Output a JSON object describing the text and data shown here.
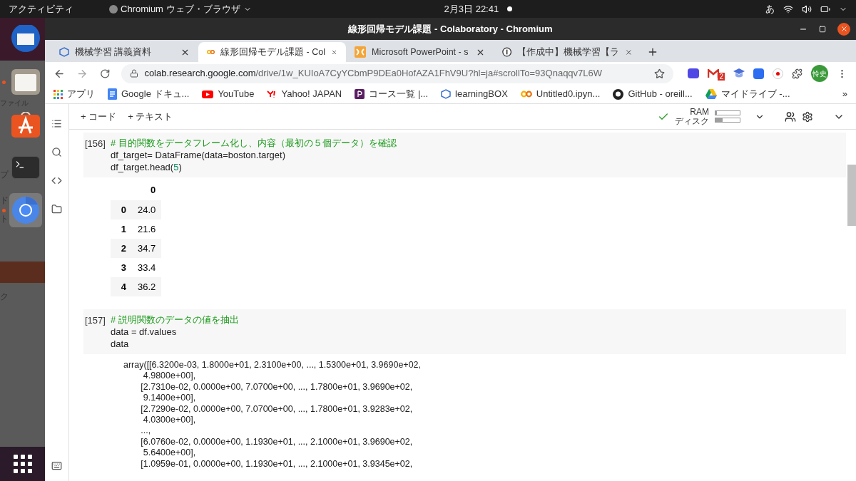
{
  "top_bar": {
    "activities": "アクティビティ",
    "app_menu": "Chromium ウェブ・ブラウザ",
    "clock": "2月3日  22:41",
    "input_method": "あ"
  },
  "dock": {
    "items": [
      {
        "kind": "mail",
        "running": false,
        "selected": false
      },
      {
        "kind": "files",
        "running": true,
        "selected": false
      },
      {
        "kind": "store",
        "running": false,
        "selected": false
      },
      {
        "kind": "terminal",
        "running": false,
        "selected": false
      },
      {
        "kind": "chromium",
        "running": true,
        "selected": true
      }
    ],
    "background_texts": [
      "ファイル",
      "プ",
      "ド",
      "ト",
      "ク"
    ]
  },
  "window": {
    "title": "線形回帰モデル課題 - Colaboratory - Chromium"
  },
  "tabs": [
    {
      "label": "機械学習 講義資料",
      "kind": "box",
      "selected": false
    },
    {
      "label": "線形回帰モデル課題 - Col",
      "kind": "colab",
      "selected": true
    },
    {
      "label": "Microsoft PowerPoint - s",
      "kind": "office",
      "selected": false
    },
    {
      "label": "【作成中】機械学習【ラ",
      "kind": "info",
      "selected": false
    }
  ],
  "address_bar": {
    "host": "colab.research.google.com",
    "path": "/drive/1w_KUIoA7CyYCbmP9DEa0HofAZA1FhV9U?hl=ja#scrollTo=93Qnaqqv7L6W"
  },
  "extensions": {
    "mail_badge": "2",
    "avatar": "怜史"
  },
  "bookmarks": [
    {
      "label": "アプリ",
      "kind": "apps"
    },
    {
      "label": "Google ドキュ...",
      "kind": "docs"
    },
    {
      "label": "YouTube",
      "kind": "youtube"
    },
    {
      "label": "Yahoo! JAPAN",
      "kind": "yahoo"
    },
    {
      "label": "コース一覧 |...",
      "kind": "course"
    },
    {
      "label": "learningBOX",
      "kind": "box"
    },
    {
      "label": "Untitled0.ipyn...",
      "kind": "colab"
    },
    {
      "label": "GitHub - oreill...",
      "kind": "github"
    },
    {
      "label": "マイドライブ -...",
      "kind": "drive"
    }
  ],
  "bookmarks_more": "»",
  "colab_toolbar": {
    "add_code": "+ コード",
    "add_text": "+ テキスト",
    "ram_label": "RAM",
    "disk_label": "ディスク",
    "ram": {
      "level": 0.05
    },
    "disk": {
      "level": 0.3
    }
  },
  "cells": [
    {
      "count": "[156]",
      "lines": [
        [
          {
            "kind": "comment",
            "text": "# 目的関数をデータフレーム化し、内容（最初の５個データ）を確認"
          }
        ],
        [
          {
            "kind": "plain",
            "text": "df_target= DataFrame(data=boston.target)"
          }
        ],
        [
          {
            "kind": "plain",
            "text": "df_target.head("
          },
          {
            "kind": "number",
            "text": "5"
          },
          {
            "kind": "plain",
            "text": ")"
          }
        ]
      ],
      "output": {
        "kind": "table",
        "header": "0",
        "rows": [
          [
            "0",
            "24.0"
          ],
          [
            "1",
            "21.6"
          ],
          [
            "2",
            "34.7"
          ],
          [
            "3",
            "33.4"
          ],
          [
            "4",
            "36.2"
          ]
        ]
      }
    },
    {
      "count": "[157]",
      "lines": [
        [
          {
            "kind": "comment",
            "text": "# 説明関数のデータの値を抽出"
          }
        ],
        [
          {
            "kind": "plain",
            "text": "data = df.values"
          }
        ],
        [
          {
            "kind": "plain",
            "text": "data"
          }
        ]
      ],
      "output": {
        "kind": "text",
        "lines": [
          "array([[6.3200e-03, 1.8000e+01, 2.3100e+00, ..., 1.5300e+01, 3.9690e+02,",
          "        4.9800e+00],",
          "       [2.7310e-02, 0.0000e+00, 7.0700e+00, ..., 1.7800e+01, 3.9690e+02,",
          "        9.1400e+00],",
          "       [2.7290e-02, 0.0000e+00, 7.0700e+00, ..., 1.7800e+01, 3.9283e+02,",
          "        4.0300e+00],",
          "       ...,",
          "       [6.0760e-02, 0.0000e+00, 1.1930e+01, ..., 2.1000e+01, 3.9690e+02,",
          "        5.6400e+00],",
          "       [1.0959e-01, 0.0000e+00, 1.1930e+01, ..., 2.1000e+01, 3.9345e+02,"
        ]
      }
    }
  ]
}
